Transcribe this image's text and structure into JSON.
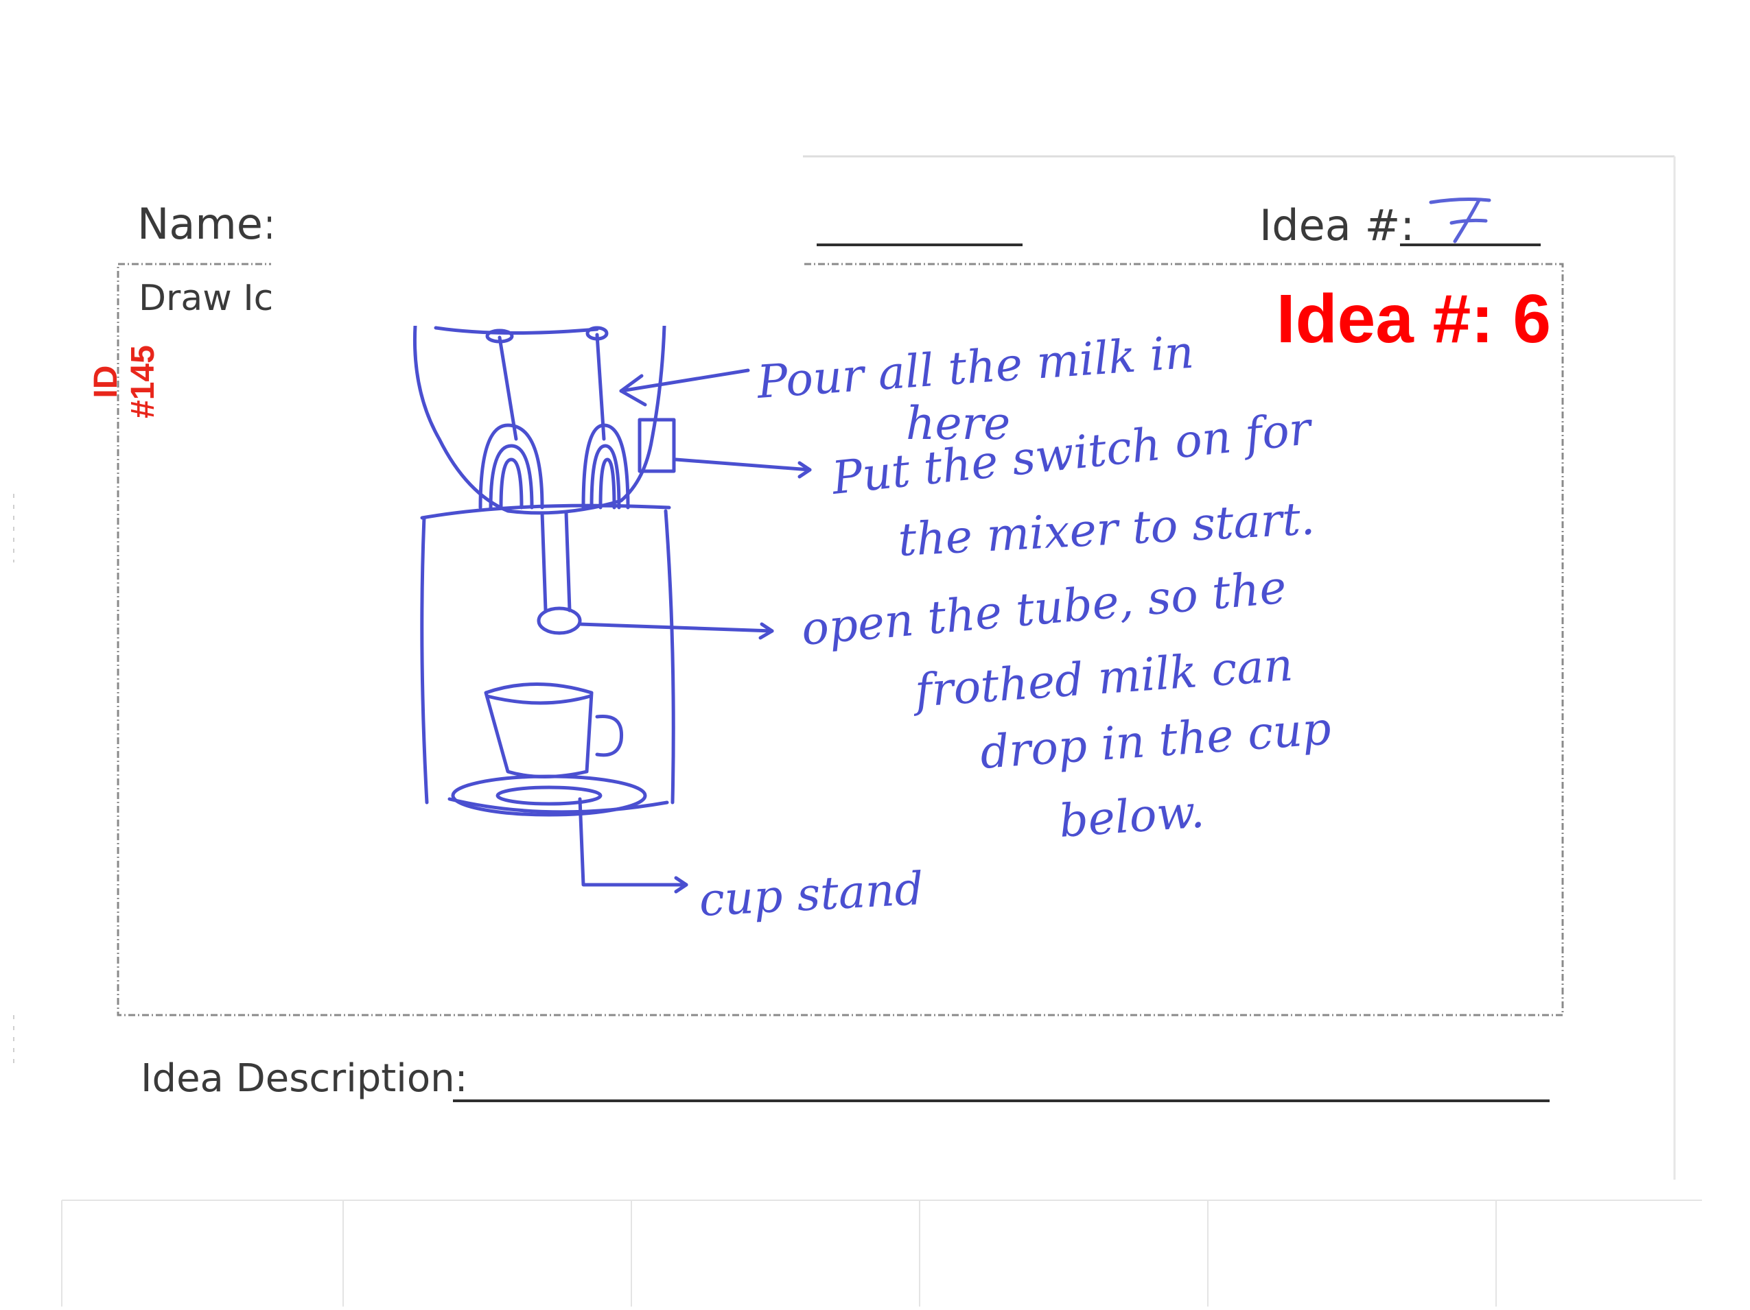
{
  "form": {
    "name_label": "Name:",
    "idea_num_label": "Idea #:",
    "handwritten_idea_num": "7",
    "draw_label": "Draw Ic",
    "description_label": "Idea Description:"
  },
  "overlay": {
    "idea_label": "Idea #: 6",
    "id_line1": "ID",
    "id_line2": "#145"
  },
  "sketch": {
    "annotations": [
      "Pour all the milk in",
      "here",
      "Put the switch on for",
      "the mixer to start.",
      "open the tube, so the",
      "frothed milk can",
      "drop in the cup",
      "below.",
      "cup stand"
    ]
  },
  "colors": {
    "ink": "#4a4fd0",
    "printed": "#3a3a3a",
    "overlay_red": "#ff0000"
  }
}
